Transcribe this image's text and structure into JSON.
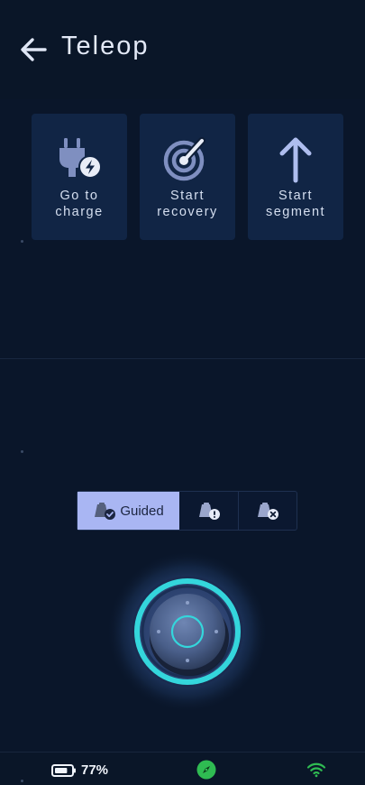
{
  "header": {
    "title": "Teleop",
    "back_icon": "arrow-left-icon"
  },
  "actions": [
    {
      "line1": "Go to",
      "line2": "charge",
      "icon": "plug-charge-icon"
    },
    {
      "line1": "Start",
      "line2": "recovery",
      "icon": "radar-icon"
    },
    {
      "line1": "Start",
      "line2": "segment",
      "icon": "arrow-up-icon"
    }
  ],
  "modes": {
    "selected": "guided",
    "guided_label": "Guided",
    "items": [
      {
        "id": "guided",
        "icon": "robot-check-icon"
      },
      {
        "id": "warning",
        "icon": "robot-alert-icon"
      },
      {
        "id": "stopped",
        "icon": "robot-cancel-icon"
      }
    ]
  },
  "joystick": {
    "ring_color": "#34d6dc"
  },
  "status": {
    "battery": "77%",
    "battery_level": 0.77,
    "compass_icon": "compass-icon",
    "wifi_icon": "wifi-icon"
  },
  "colors": {
    "background": "#0a162a",
    "card": "#112545",
    "accent": "#a9b6f3",
    "icon": "#7f8fc0",
    "status_green": "#2fbb52"
  }
}
